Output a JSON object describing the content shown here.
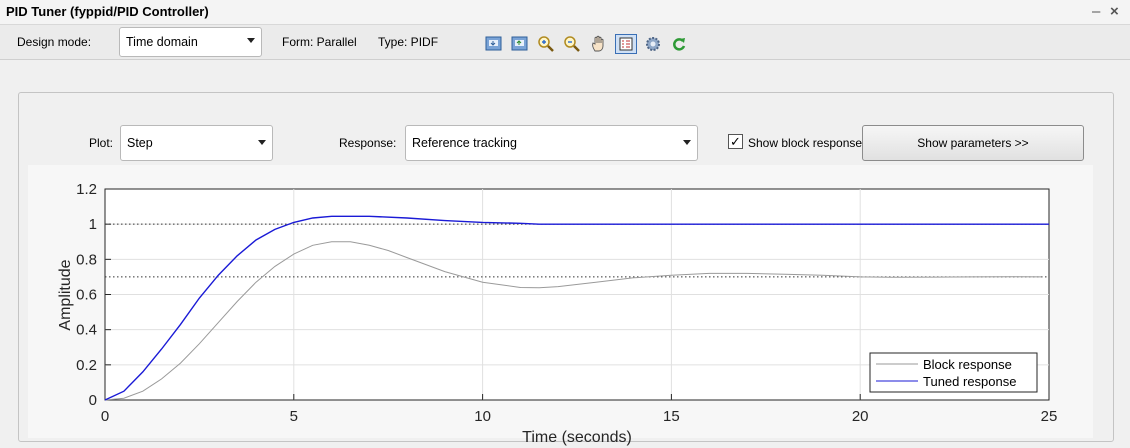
{
  "window": {
    "title": "PID Tuner (fyppid/PID Controller)",
    "minimize": "–",
    "close": "×"
  },
  "toolbar": {
    "design_mode_label": "Design mode:",
    "design_mode_value": "Time domain",
    "form_label": "Form: Parallel",
    "type_label": "Type: PIDF",
    "icons": [
      "import-icon",
      "export-icon",
      "zoom-in-icon",
      "zoom-out-icon",
      "pan-hand-icon",
      "legend-toggle-icon",
      "preferences-gear-icon",
      "refresh-icon"
    ]
  },
  "controls": {
    "plot_label": "Plot:",
    "plot_value": "Step",
    "response_label": "Response:",
    "response_value": "Reference tracking",
    "show_block_label": "Show block response",
    "show_block_checked": true,
    "show_params_label": "Show parameters >>"
  },
  "chart_data": {
    "type": "line",
    "xlabel": "Time (seconds)",
    "ylabel": "Amplitude",
    "xlim": [
      0,
      25
    ],
    "ylim": [
      0,
      1.2
    ],
    "xticks": [
      "0",
      "5",
      "10",
      "15",
      "20",
      "25"
    ],
    "yticks": [
      "0",
      "0.2",
      "0.4",
      "0.6",
      "0.8",
      "1",
      "1.2"
    ],
    "grid": true,
    "legend_position": "bottom-right",
    "reference_lines": [
      1,
      0.7
    ],
    "series": [
      {
        "name": "Block response",
        "color": "#9a9a9a",
        "x": [
          0,
          0.5,
          1,
          1.5,
          2,
          2.5,
          3,
          3.5,
          4,
          4.5,
          5,
          5.5,
          6,
          6.5,
          7,
          7.5,
          8,
          9,
          10,
          11,
          11.5,
          12,
          13,
          14,
          15,
          16,
          17,
          18,
          19,
          20,
          21,
          22,
          23,
          24,
          24.8
        ],
        "y": [
          0,
          0.01,
          0.05,
          0.12,
          0.21,
          0.32,
          0.44,
          0.56,
          0.67,
          0.76,
          0.83,
          0.88,
          0.9,
          0.9,
          0.88,
          0.85,
          0.81,
          0.73,
          0.67,
          0.64,
          0.638,
          0.645,
          0.67,
          0.695,
          0.71,
          0.72,
          0.72,
          0.715,
          0.71,
          0.7,
          0.698,
          0.699,
          0.7,
          0.701,
          0.7
        ]
      },
      {
        "name": "Tuned response",
        "color": "#1a1ad6",
        "x": [
          0,
          0.5,
          1,
          1.5,
          2,
          2.5,
          3,
          3.5,
          4,
          4.5,
          5,
          5.5,
          6,
          7,
          8,
          9,
          10,
          11,
          11.5,
          12,
          14,
          16,
          18,
          20,
          22,
          25
        ],
        "y": [
          0,
          0.05,
          0.16,
          0.29,
          0.43,
          0.58,
          0.71,
          0.82,
          0.91,
          0.97,
          1.01,
          1.035,
          1.045,
          1.045,
          1.035,
          1.02,
          1.01,
          1.005,
          1.0,
          1.0,
          1.0,
          1.0,
          1.0,
          1.0,
          1.0,
          1.0
        ]
      }
    ]
  }
}
